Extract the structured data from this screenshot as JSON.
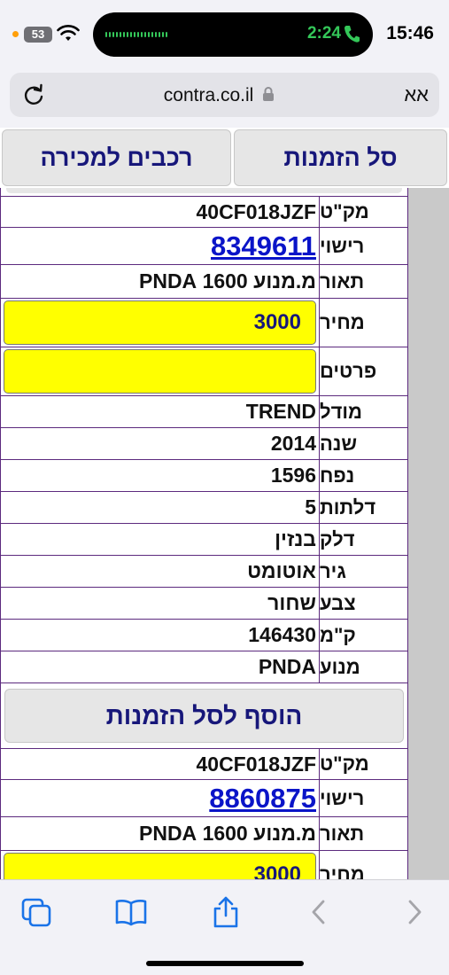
{
  "status_bar": {
    "signal_badge": "53",
    "call_time": "2:24",
    "clock": "15:46"
  },
  "address_bar": {
    "url": "contra.co.il",
    "reader_label": "אא"
  },
  "tabs": {
    "cart": "סל הזמנות",
    "cars_for_sale": "רכבים למכירה"
  },
  "listings": [
    {
      "rows": [
        {
          "label": "מק\"ט",
          "value": "40CF018JZF"
        },
        {
          "label": "רישוי",
          "value": "8349611"
        },
        {
          "label": "תאור",
          "value": "מ.מנוע 1600 PNDA"
        },
        {
          "label": "מחיר",
          "value": "3000"
        },
        {
          "label": "פרטים",
          "value": ""
        },
        {
          "label": "מודל",
          "value": "TREND"
        },
        {
          "label": "שנה",
          "value": "2014"
        },
        {
          "label": "נפח",
          "value": "1596"
        },
        {
          "label": "דלתות",
          "value": "5"
        },
        {
          "label": "דלק",
          "value": "בנזין"
        },
        {
          "label": "גיר",
          "value": "אוטומט"
        },
        {
          "label": "צבע",
          "value": "שחור"
        },
        {
          "label": "ק\"מ",
          "value": "146430"
        },
        {
          "label": "מנוע",
          "value": "PNDA"
        }
      ],
      "add_button": "הוסף לסל הזמנות"
    },
    {
      "rows": [
        {
          "label": "מק\"ט",
          "value": "40CF018JZF"
        },
        {
          "label": "רישוי",
          "value": "8860875"
        },
        {
          "label": "תאור",
          "value": "מ.מנוע 1600 PNDA"
        },
        {
          "label": "מחיר",
          "value": "3000"
        }
      ]
    }
  ],
  "toolbar": {
    "icons": [
      "tabs-icon",
      "bookmarks-icon",
      "share-icon",
      "back-icon",
      "forward-icon"
    ]
  },
  "colors": {
    "accent_text": "#17177a",
    "link": "#0a14c8",
    "highlight": "#ffff00",
    "table_border": "#5c2a7e",
    "call_green": "#34c759",
    "ios_blue": "#1a73e8"
  }
}
